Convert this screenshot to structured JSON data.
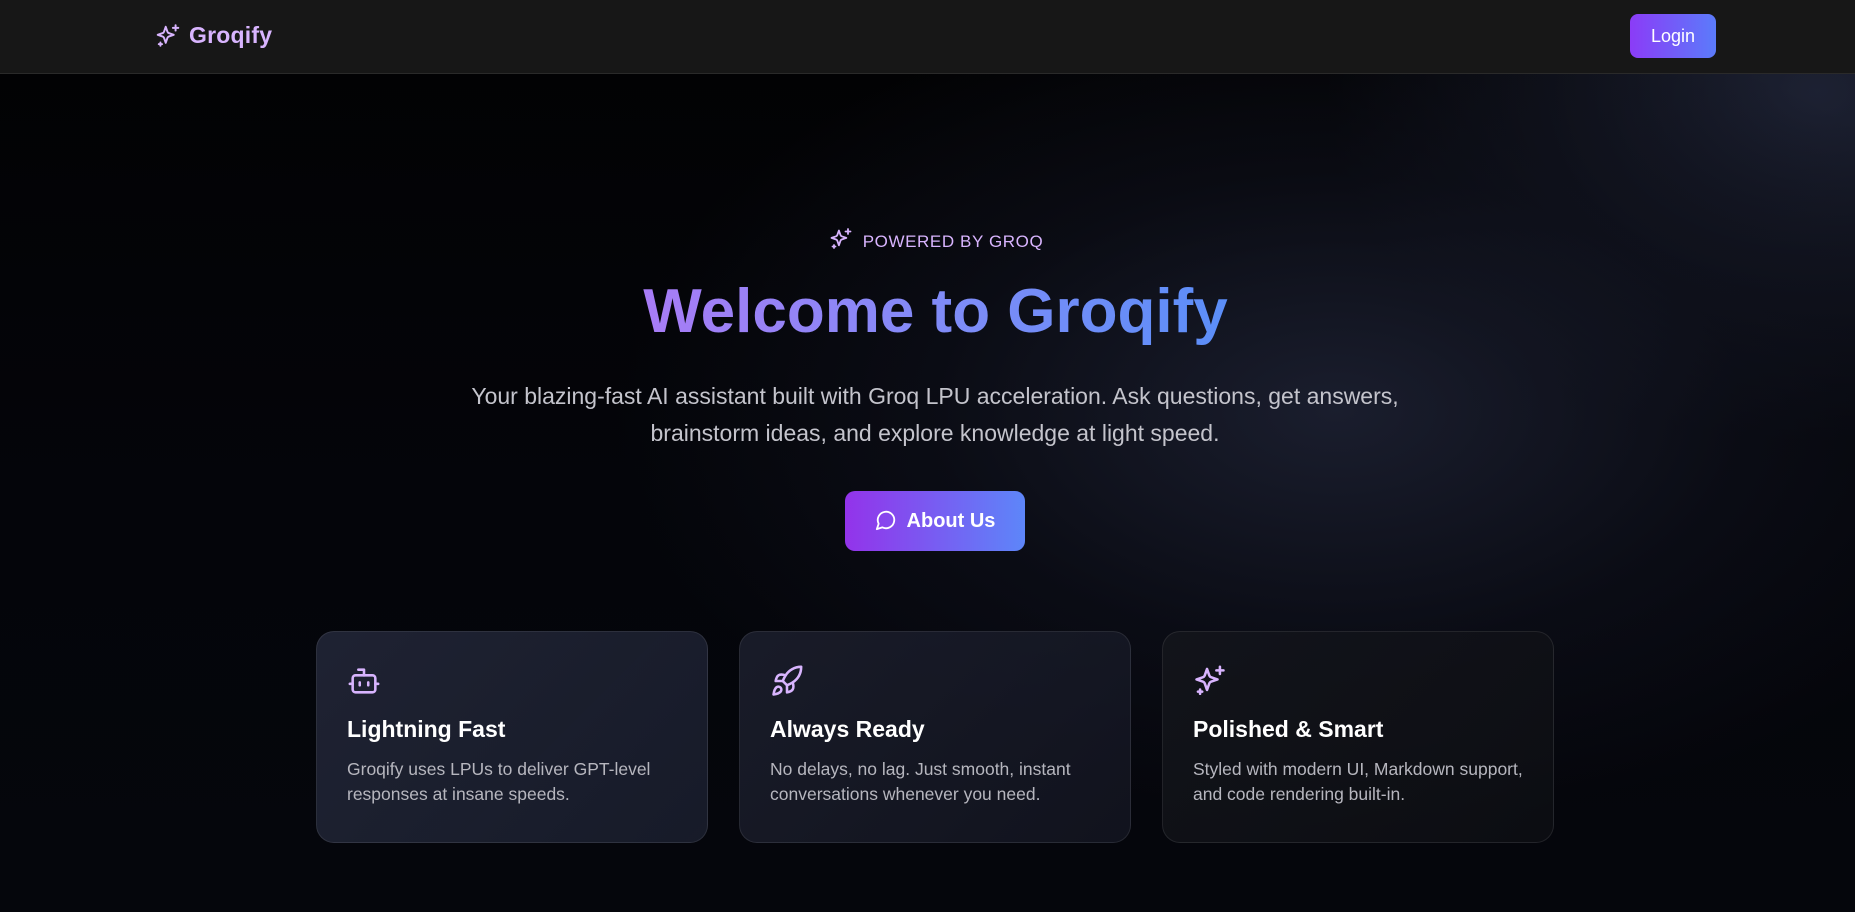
{
  "nav": {
    "brand_name": "Groqify",
    "brand_icon": "sparkles-icon",
    "login_label": "Login"
  },
  "hero": {
    "eyebrow_icon": "sparkles-icon",
    "eyebrow": "POWERED BY GROQ",
    "title": "Welcome to Groqify",
    "subtitle": "Your blazing-fast AI assistant built with Groq LPU acceleration. Ask questions, get answers, brainstorm ideas, and explore knowledge at light speed.",
    "cta_icon": "message-circle-icon",
    "cta_label": "About Us"
  },
  "features": [
    {
      "icon": "bot-icon",
      "title": "Lightning Fast",
      "description": "Groqify uses LPUs to deliver GPT-level responses at insane speeds."
    },
    {
      "icon": "rocket-icon",
      "title": "Always Ready",
      "description": "No delays, no lag. Just smooth, instant conversations whenever you need."
    },
    {
      "icon": "sparkles-icon",
      "title": "Polished & Smart",
      "description": "Styled with modern UI, Markdown support, and code rendering built-in."
    }
  ],
  "colors": {
    "accent_purple": "#d8b4fe",
    "gradient_start": "#9333ea",
    "gradient_end": "#5b8ef8",
    "nav_background": "#171717"
  }
}
